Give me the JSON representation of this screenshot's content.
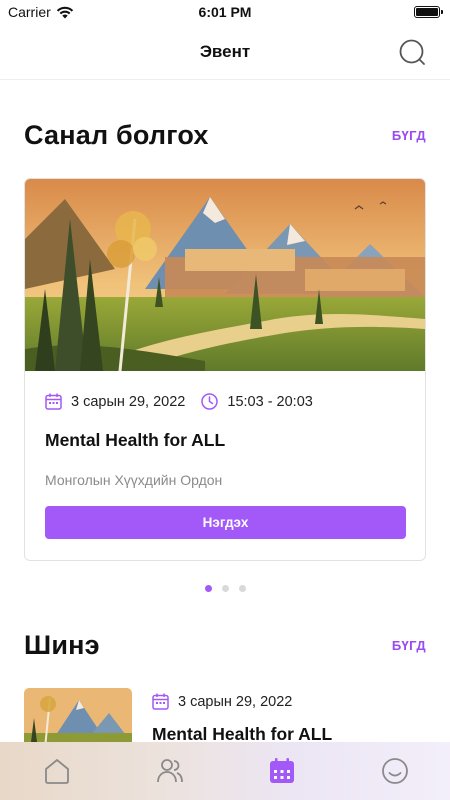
{
  "status_bar": {
    "carrier": "Carrier",
    "time": "6:01 PM"
  },
  "nav": {
    "title": "Эвент",
    "search_icon": "search-icon"
  },
  "recommended": {
    "title": "Санал болгох",
    "see_all": "БҮГД",
    "card": {
      "date": "3 сарын 29, 2022",
      "time": "15:03 - 20:03",
      "title": "Mental Health for ALL",
      "organizer": "Монголын Хүүхдийн Ордон",
      "join_label": "Нэгдэх"
    },
    "carousel": {
      "pages": 3,
      "active_index": 0
    }
  },
  "new": {
    "title": "Шинэ",
    "see_all": "БҮГД",
    "item": {
      "date": "3 сарын 29, 2022",
      "title": "Mental Health for ALL"
    }
  },
  "tab_bar": {
    "tabs": [
      "home-icon",
      "users-icon",
      "calendar-icon",
      "profile-smile-icon"
    ],
    "active": "calendar-icon"
  },
  "colors": {
    "accent": "#a259f7",
    "muted_text": "#8a8a8a",
    "divider": "#e2e2e2"
  }
}
